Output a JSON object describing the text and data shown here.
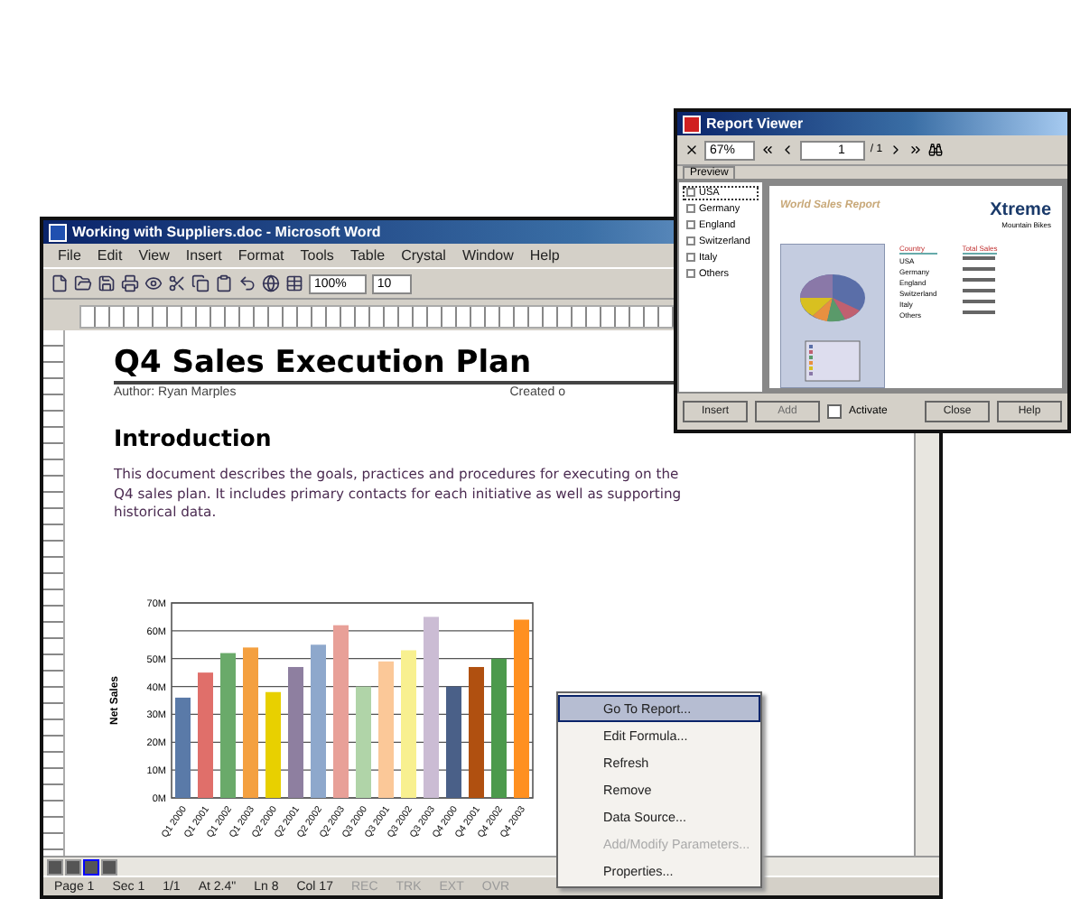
{
  "word_window": {
    "title": "Working with Suppliers.doc - Microsoft Word",
    "menu": [
      "File",
      "Edit",
      "View",
      "Insert",
      "Format",
      "Tools",
      "Table",
      "Crystal",
      "Window",
      "Help"
    ],
    "toolbar": {
      "zoom": "100%",
      "font_size": "10"
    },
    "document": {
      "heading": "Q4 Sales Execution Plan",
      "author": "Author: Ryan Marples",
      "created": "Created o",
      "section_heading": "Introduction",
      "paragraph": "This document describes the goals, practices and procedures for executing on the Q4 sales plan. It includes primary contacts for each initiative as well as supporting historical data.",
      "chart_data": {
        "type": "bar",
        "ylabel": "Net Sales",
        "categories": [
          "Q1 2000",
          "Q1 2001",
          "Q1 2002",
          "Q1 2003",
          "Q2 2000",
          "Q2 2001",
          "Q2 2002",
          "Q2 2003",
          "Q3 2000",
          "Q3 2001",
          "Q3 2002",
          "Q3 2003",
          "Q4 2000",
          "Q4 2001",
          "Q4 2002",
          "Q4 2003"
        ],
        "series": [
          {
            "colors": [
              "#5a7aa8",
              "#e06f6a",
              "#6aaa6a",
              "#f4a040",
              "#e8d000",
              "#8e7fa0",
              "#8ea8cc",
              "#e8a098",
              "#b0d4a8",
              "#fbc898",
              "#f8f090",
              "#cbbcd4",
              "#4a6088",
              "#b05010",
              "#4c9a4c",
              "#ff9020"
            ],
            "values": [
              36,
              45,
              52,
              54,
              38,
              47,
              55,
              62,
              40,
              49,
              53,
              65,
              40,
              47,
              50,
              64
            ]
          }
        ],
        "grid": true,
        "ylim": [
          0,
          70
        ],
        "yticks": [
          {
            "value": 0,
            "label": "0M"
          },
          {
            "value": 10,
            "label": "10M"
          },
          {
            "value": 20,
            "label": "20M"
          },
          {
            "value": 30,
            "label": "30M"
          },
          {
            "value": 40,
            "label": "40M"
          },
          {
            "value": 50,
            "label": "50M"
          },
          {
            "value": 60,
            "label": "60M"
          },
          {
            "value": 70,
            "label": "70M"
          }
        ]
      }
    },
    "context_menu": [
      {
        "label": "Go To Report...",
        "selected": true,
        "disabled": false
      },
      {
        "label": "Edit Formula...",
        "selected": false,
        "disabled": false
      },
      {
        "label": "Refresh",
        "selected": false,
        "disabled": false
      },
      {
        "label": "Remove",
        "selected": false,
        "disabled": false
      },
      {
        "label": "Data Source...",
        "selected": false,
        "disabled": false
      },
      {
        "label": "Add/Modify Parameters...",
        "selected": false,
        "disabled": true
      },
      {
        "label": "Properties...",
        "selected": false,
        "disabled": false
      }
    ],
    "status_bar": [
      {
        "text": "Page 1",
        "dimmed": false
      },
      {
        "text": "Sec 1",
        "dimmed": false
      },
      {
        "text": "1/1",
        "dimmed": false
      },
      {
        "text": "At 2.4\"",
        "dimmed": false
      },
      {
        "text": "Ln 8",
        "dimmed": false
      },
      {
        "text": "Col 17",
        "dimmed": false
      },
      {
        "text": "REC",
        "dimmed": true
      },
      {
        "text": "TRK",
        "dimmed": true
      },
      {
        "text": "EXT",
        "dimmed": true
      },
      {
        "text": "OVR",
        "dimmed": true
      }
    ]
  },
  "report_viewer": {
    "title": "Report Viewer",
    "zoom": "67%",
    "page": "1",
    "page_count": "/ 1",
    "tabs": [
      {
        "label": "Preview",
        "selected": true
      }
    ],
    "tree": [
      {
        "label": "USA",
        "selected": true
      },
      {
        "label": "Germany",
        "selected": false
      },
      {
        "label": "England",
        "selected": false
      },
      {
        "label": "Switzerland",
        "selected": false
      },
      {
        "label": "Italy",
        "selected": false
      },
      {
        "label": "Others",
        "selected": false
      }
    ],
    "report": {
      "title": "World Sales Report",
      "logo": "Xtreme",
      "logo_subtitle": "Mountain Bikes",
      "columns": [
        "Country",
        "Total Sales"
      ],
      "rows": [
        "USA",
        "Germany",
        "England",
        "Switzerland",
        "Italy",
        "Others"
      ]
    },
    "buttons": [
      {
        "label": "Insert",
        "disabled": false
      },
      {
        "label": "Add",
        "disabled": true
      },
      {
        "label": "Close",
        "disabled": false
      },
      {
        "label": "Help",
        "disabled": false
      }
    ],
    "checkbox": {
      "label": "Activate",
      "checked": false
    }
  }
}
